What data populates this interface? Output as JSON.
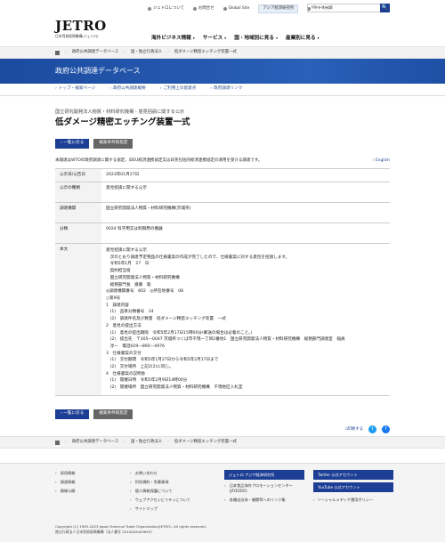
{
  "header": {
    "logo": "JETRO",
    "logo_sub": "日本貿易振興機構(ジェトロ)",
    "util": [
      "ジェトロについて",
      "お問合せ",
      "Global Site",
      "アジア経済研究所"
    ],
    "mypage": "マイページ",
    "search_placeholder": "サイト内検索",
    "search_button": "🔍"
  },
  "gnav": [
    "海外ビジネス情報",
    "サービス",
    "国・地域別に見る",
    "産業別に見る"
  ],
  "breadcrumb": [
    "政府公共調達データベース",
    "国・独立行政法人",
    "低ダメージ精密エッチング装置一式"
  ],
  "hero": "政府公共調達データベース",
  "subnav": [
    "トップ・検索ページ",
    "政府公共調達概要",
    "ご利用上の留意点",
    "政府調達リンク"
  ],
  "kicker": "国立研究開発法人物質・材料研究機構 - 意見招請に関する公示",
  "title": "低ダメージ精密エッチング装置一式",
  "buttons": {
    "back": "一覧に戻る",
    "edit": "検索条件再指定"
  },
  "note": "本調達はWTOの政府調達に関する協定、日EU経済連携協定又は日英包括的経済連携協定の適用を受ける調達です。",
  "english": "English",
  "table": [
    {
      "label": "公示日/公告日",
      "value": "2023年01月27日"
    },
    {
      "label": "公示の種類",
      "value": "意見招請に関する公示"
    },
    {
      "label": "調達機関",
      "value": "国立研究開発法人物質・材料研究機構(茨城県)"
    },
    {
      "label": "分類",
      "value": "0024 科学用又は制御用の機器"
    }
  ],
  "body_label": "本文",
  "body_lines": [
    "意見招請に関する公示",
    "　次のとおり調達予定物品の仕様書案の作成が完了したので、仕様書案に対する意見を招請します。",
    "　令和5年1月　27　日",
    "　契約担当役",
    "　国立研究開発法人物質・材料研究機構",
    "　総務部門長　齋藤　聡",
    "◎調達機関番号　802　◎所在地番号　08",
    "○第9号",
    "1　調達内容",
    "　(1)　品目分類番号　24",
    "　(2)　調達件名及び数量　低ダメージ精密エッチング装置　一式",
    "2　意見の提出方法",
    "　(1)　意見の提出期限　令和5年2月17日15時00分(郵送の場合は必着のこと。)",
    "　(2)　提出先　〒305―0047 茨城県つくば市千現一丁目2番地1　国立研究開発法人物質・材料研究機構　総務部門調達室　稲員",
    "　淳一　電話029―860―4976",
    "3　仕様書案の交付",
    "　(1)　交付期間　令和5年1月27日から令和5年2月17日まで",
    "　(2)　交付場所　上記2(2)に同じ。",
    "4　仕様書案の説明会",
    "　(1)　開催日時　令和5年2月9日14時00分",
    "　(2)　開催場所　国立研究開発法人物質・材料研究機構　千現地区入札室"
  ],
  "share": {
    "print": "印刷する"
  },
  "footer": {
    "col1": [
      "採用情報",
      "調達情報",
      "情報公開"
    ],
    "col2": [
      "お問い合わせ",
      "利用規約・免責事項",
      "個人情報保護について",
      "ウェブアクセシビリティについて",
      "サイトマップ"
    ],
    "col3_button": "ジェトロ アジア経済研究所",
    "col3": [
      "日本食品海外プロモーションセンター(JFOODO)",
      "各種自治体・機関等へのリンク集"
    ],
    "social": [
      "Twitter 公式アカウント",
      "YouTube 公式アカウント"
    ],
    "social_plain": "ソーシャルメディア運用ポリシー",
    "copyright": "Copyright (C) 1995-2023 Japan External Trade Organization(JETRO). All rights reserved.",
    "corporate": "独立行政法人日本貿易振興機構（法人番号 2010405003693）"
  },
  "colors": {
    "brand": "#1c3f95",
    "hero": "#1c4fa3"
  }
}
